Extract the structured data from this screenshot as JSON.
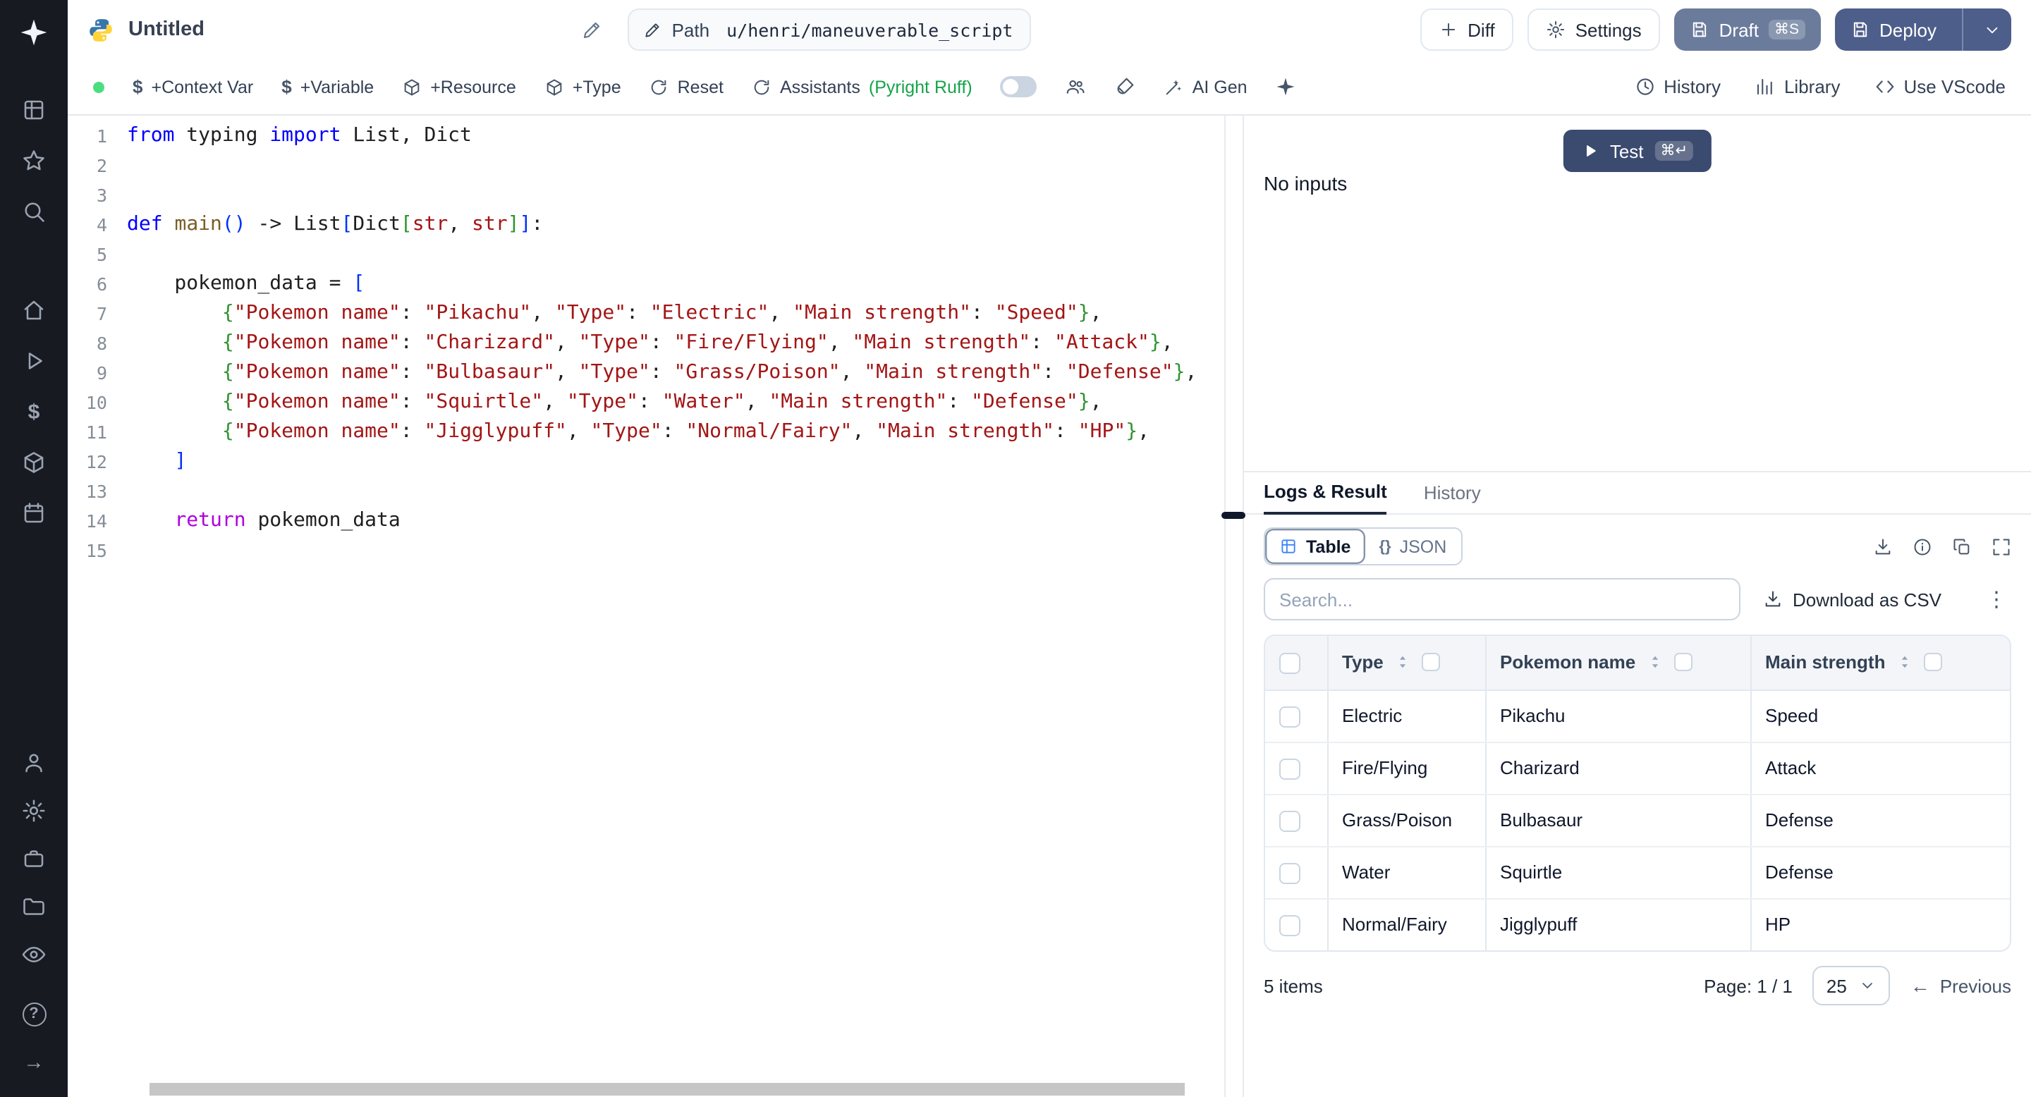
{
  "topbar": {
    "title": "Untitled",
    "path_label": "Path",
    "path_value": "u/henri/maneuverable_script",
    "diff": "Diff",
    "settings": "Settings",
    "draft": "Draft",
    "draft_kbd": "⌘S",
    "deploy": "Deploy"
  },
  "toolbar": {
    "context_var": "+Context Var",
    "variable": "+Variable",
    "resource": "+Resource",
    "type": "+Type",
    "reset": "Reset",
    "assistants": "Assistants",
    "assistants_hint": "(Pyright Ruff)",
    "ai_gen": "AI Gen",
    "history": "History",
    "library": "Library",
    "use_vscode": "Use VScode"
  },
  "editor": {
    "language": "python",
    "code_lines": [
      [
        [
          "from",
          "k"
        ],
        [
          " typing ",
          "p"
        ],
        [
          "import",
          "k"
        ],
        [
          " List, Dict",
          "p"
        ]
      ],
      [],
      [],
      [
        [
          "def",
          "k"
        ],
        [
          " ",
          "p"
        ],
        [
          "main",
          "f"
        ],
        [
          "(",
          "b1"
        ],
        [
          ")",
          "b1"
        ],
        [
          " -> List",
          "p"
        ],
        [
          "[",
          "b1"
        ],
        [
          "Dict",
          "p"
        ],
        [
          "[",
          "b2"
        ],
        [
          "str",
          "t"
        ],
        [
          ", ",
          "p"
        ],
        [
          "str",
          "t"
        ],
        [
          "]",
          "b2"
        ],
        [
          "]",
          "b1"
        ],
        [
          ":",
          "p"
        ]
      ],
      [],
      [
        [
          "    pokemon_data = ",
          "p"
        ],
        [
          "[",
          "b1"
        ]
      ],
      [
        [
          "        ",
          "p"
        ],
        [
          "{",
          "b2"
        ],
        [
          "\"Pokemon name\"",
          "s"
        ],
        [
          ": ",
          "p"
        ],
        [
          "\"Pikachu\"",
          "s"
        ],
        [
          ", ",
          "p"
        ],
        [
          "\"Type\"",
          "s"
        ],
        [
          ": ",
          "p"
        ],
        [
          "\"Electric\"",
          "s"
        ],
        [
          ", ",
          "p"
        ],
        [
          "\"Main strength\"",
          "s"
        ],
        [
          ": ",
          "p"
        ],
        [
          "\"Speed\"",
          "s"
        ],
        [
          "}",
          "b2"
        ],
        [
          ",",
          "p"
        ]
      ],
      [
        [
          "        ",
          "p"
        ],
        [
          "{",
          "b2"
        ],
        [
          "\"Pokemon name\"",
          "s"
        ],
        [
          ": ",
          "p"
        ],
        [
          "\"Charizard\"",
          "s"
        ],
        [
          ", ",
          "p"
        ],
        [
          "\"Type\"",
          "s"
        ],
        [
          ": ",
          "p"
        ],
        [
          "\"Fire/Flying\"",
          "s"
        ],
        [
          ", ",
          "p"
        ],
        [
          "\"Main strength\"",
          "s"
        ],
        [
          ": ",
          "p"
        ],
        [
          "\"Attack\"",
          "s"
        ],
        [
          "}",
          "b2"
        ],
        [
          ",",
          "p"
        ]
      ],
      [
        [
          "        ",
          "p"
        ],
        [
          "{",
          "b2"
        ],
        [
          "\"Pokemon name\"",
          "s"
        ],
        [
          ": ",
          "p"
        ],
        [
          "\"Bulbasaur\"",
          "s"
        ],
        [
          ", ",
          "p"
        ],
        [
          "\"Type\"",
          "s"
        ],
        [
          ": ",
          "p"
        ],
        [
          "\"Grass/Poison\"",
          "s"
        ],
        [
          ", ",
          "p"
        ],
        [
          "\"Main strength\"",
          "s"
        ],
        [
          ": ",
          "p"
        ],
        [
          "\"Defense\"",
          "s"
        ],
        [
          "}",
          "b2"
        ],
        [
          ",",
          "p"
        ]
      ],
      [
        [
          "        ",
          "p"
        ],
        [
          "{",
          "b2"
        ],
        [
          "\"Pokemon name\"",
          "s"
        ],
        [
          ": ",
          "p"
        ],
        [
          "\"Squirtle\"",
          "s"
        ],
        [
          ", ",
          "p"
        ],
        [
          "\"Type\"",
          "s"
        ],
        [
          ": ",
          "p"
        ],
        [
          "\"Water\"",
          "s"
        ],
        [
          ", ",
          "p"
        ],
        [
          "\"Main strength\"",
          "s"
        ],
        [
          ": ",
          "p"
        ],
        [
          "\"Defense\"",
          "s"
        ],
        [
          "}",
          "b2"
        ],
        [
          ",",
          "p"
        ]
      ],
      [
        [
          "        ",
          "p"
        ],
        [
          "{",
          "b2"
        ],
        [
          "\"Pokemon name\"",
          "s"
        ],
        [
          ": ",
          "p"
        ],
        [
          "\"Jigglypuff\"",
          "s"
        ],
        [
          ", ",
          "p"
        ],
        [
          "\"Type\"",
          "s"
        ],
        [
          ": ",
          "p"
        ],
        [
          "\"Normal/Fairy\"",
          "s"
        ],
        [
          ", ",
          "p"
        ],
        [
          "\"Main strength\"",
          "s"
        ],
        [
          ": ",
          "p"
        ],
        [
          "\"HP\"",
          "s"
        ],
        [
          "}",
          "b2"
        ],
        [
          ",",
          "p"
        ]
      ],
      [
        [
          "    ",
          "p"
        ],
        [
          "]",
          "b1"
        ]
      ],
      [],
      [
        [
          "    ",
          "p"
        ],
        [
          "return",
          "c"
        ],
        [
          " pokemon_data",
          "p"
        ]
      ],
      []
    ]
  },
  "preview": {
    "test_label": "Test",
    "test_kbd": "⌘↵",
    "no_inputs": "No inputs"
  },
  "results": {
    "tabs": [
      "Logs & Result",
      "History"
    ],
    "active_tab": "Logs & Result",
    "view_table": "Table",
    "view_json": "JSON",
    "json_glyph": "{}",
    "search_placeholder": "Search...",
    "download_csv": "Download as CSV",
    "table": {
      "columns": [
        "Type",
        "Pokemon name",
        "Main strength"
      ],
      "rows": [
        [
          "Electric",
          "Pikachu",
          "Speed"
        ],
        [
          "Fire/Flying",
          "Charizard",
          "Attack"
        ],
        [
          "Grass/Poison",
          "Bulbasaur",
          "Defense"
        ],
        [
          "Water",
          "Squirtle",
          "Defense"
        ],
        [
          "Normal/Fairy",
          "Jigglypuff",
          "HP"
        ]
      ]
    },
    "footer": {
      "items_count": "5 items",
      "page_label": "Page: 1 / 1",
      "page_size": "25",
      "previous": "Previous"
    }
  },
  "glyphs": {
    "dollar": "$",
    "help": "?",
    "collapse_arrow": "→",
    "kebab": "⋮",
    "prev_arrow": "←"
  },
  "colors": {
    "accent-blue": "#3b82f6",
    "draft-bg": "#6b7b9c",
    "deploy-bg": "#4d5e8a",
    "test-bg": "#3b4a6f",
    "green-dot": "#4ade80",
    "assistants-green": "#16a34a",
    "keyword": "#0000ff",
    "control": "#af00db",
    "string": "#a31515",
    "func": "#795E26",
    "plain": "#1f1f1f",
    "bracket1": "#0431fa",
    "bracket2": "#319331",
    "linenum": "#858d97"
  }
}
